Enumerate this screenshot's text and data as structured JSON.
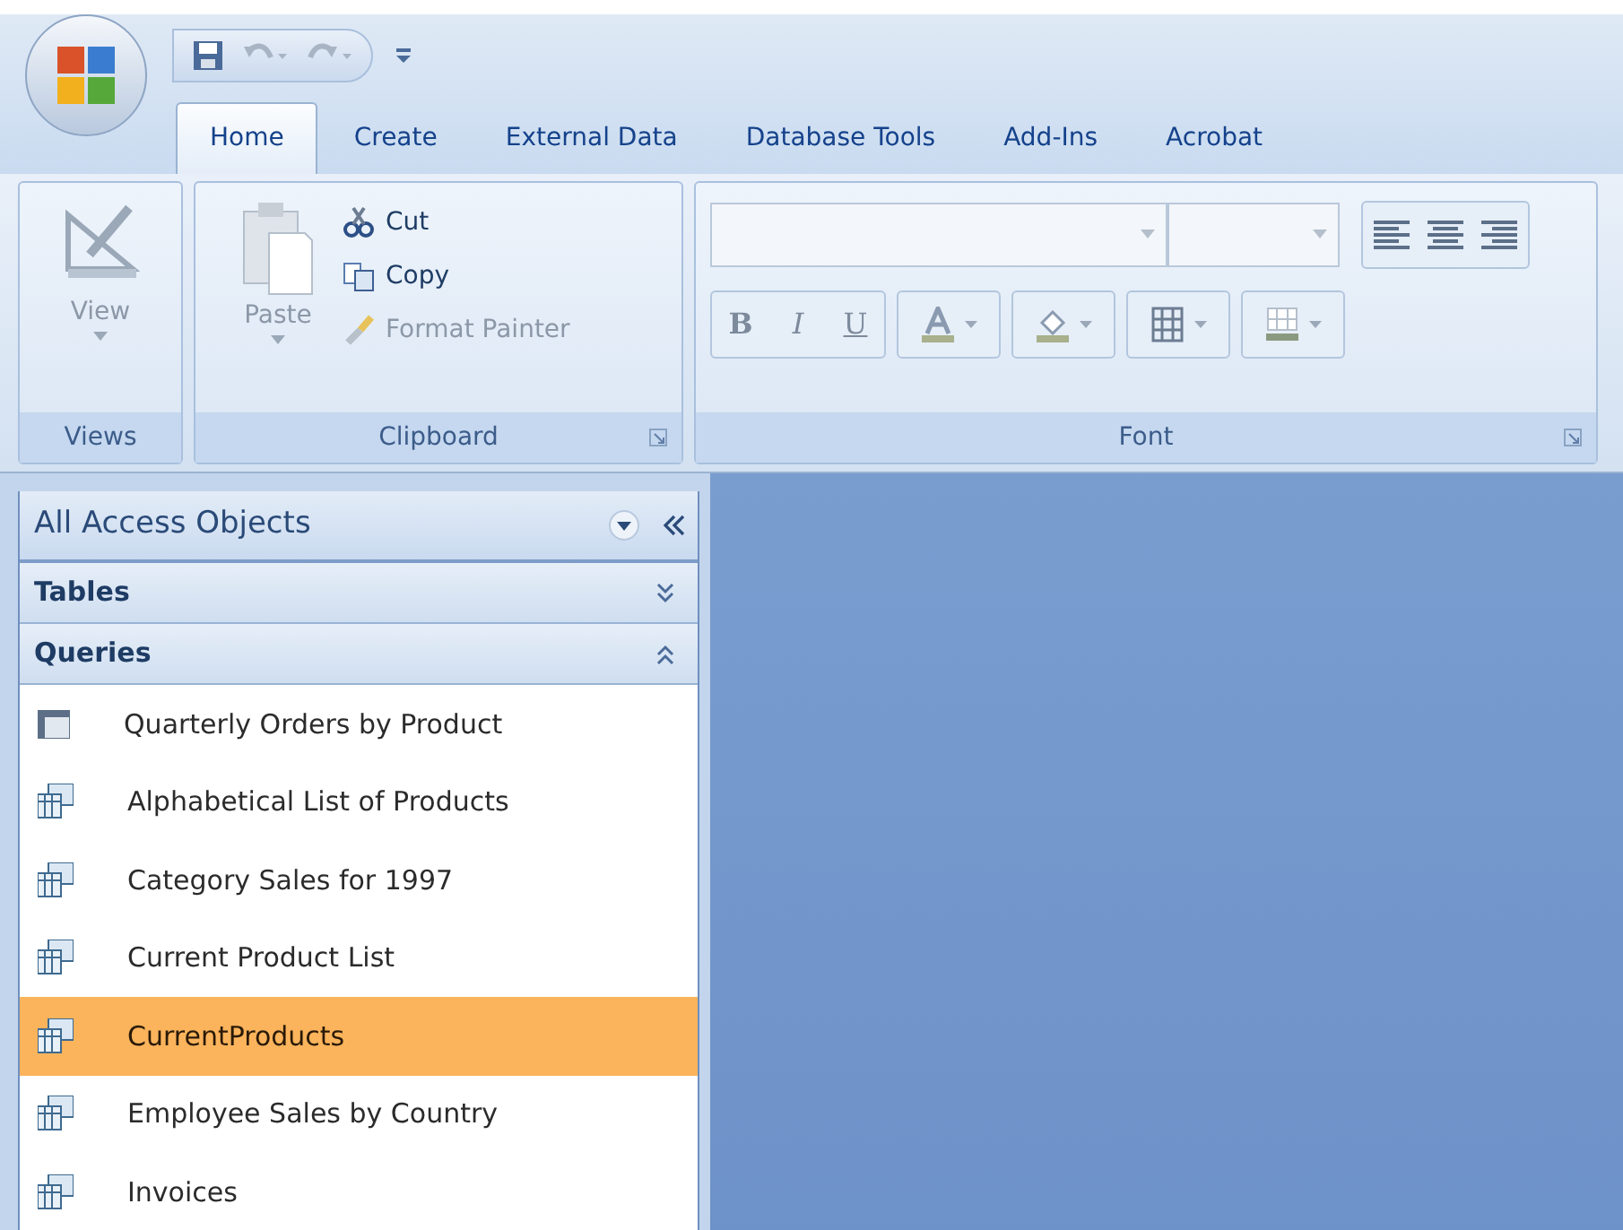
{
  "quick_access": {
    "items": [
      {
        "kind": "save",
        "disabled": false
      },
      {
        "kind": "undo",
        "disabled": true
      },
      {
        "kind": "redo",
        "disabled": true
      },
      {
        "kind": "customize",
        "disabled": false
      }
    ]
  },
  "tabs": [
    {
      "label": "Home",
      "selected": true
    },
    {
      "label": "Create",
      "selected": false
    },
    {
      "label": "External Data",
      "selected": false
    },
    {
      "label": "Database Tools",
      "selected": false
    },
    {
      "label": "Add-Ins",
      "selected": false
    },
    {
      "label": "Acrobat",
      "selected": false
    }
  ],
  "ribbon": {
    "groups": [
      {
        "kind": "views",
        "label": "Views",
        "buttons": [
          {
            "label": "View",
            "disabled": true
          }
        ]
      },
      {
        "kind": "clipboard",
        "label": "Clipboard",
        "buttons": [
          {
            "label": "Paste",
            "disabled": true
          },
          {
            "label": "Cut",
            "disabled": false
          },
          {
            "label": "Copy",
            "disabled": false
          },
          {
            "label": "Format Painter",
            "disabled": true
          }
        ]
      },
      {
        "kind": "font",
        "label": "Font",
        "buttons": [
          {
            "label": "B",
            "disabled": true
          },
          {
            "label": "I",
            "disabled": true
          },
          {
            "label": "U",
            "disabled": true
          }
        ]
      }
    ]
  },
  "navigation_pane": {
    "title": "All Access Objects",
    "sections": [
      {
        "label": "Tables",
        "expanded": false
      },
      {
        "label": "Queries",
        "expanded": true,
        "items": [
          {
            "label": "Quarterly Orders by Product",
            "kind": "crosstab",
            "selected": false
          },
          {
            "label": "Alphabetical List of Products",
            "kind": "select",
            "selected": false
          },
          {
            "label": "Category Sales for 1997",
            "kind": "select",
            "selected": false
          },
          {
            "label": "Current Product List",
            "kind": "select",
            "selected": false
          },
          {
            "label": "CurrentProducts",
            "kind": "select",
            "selected": true
          },
          {
            "label": "Employee Sales by Country",
            "kind": "select",
            "selected": false
          },
          {
            "label": "Invoices",
            "kind": "select",
            "selected": false
          }
        ]
      }
    ]
  }
}
